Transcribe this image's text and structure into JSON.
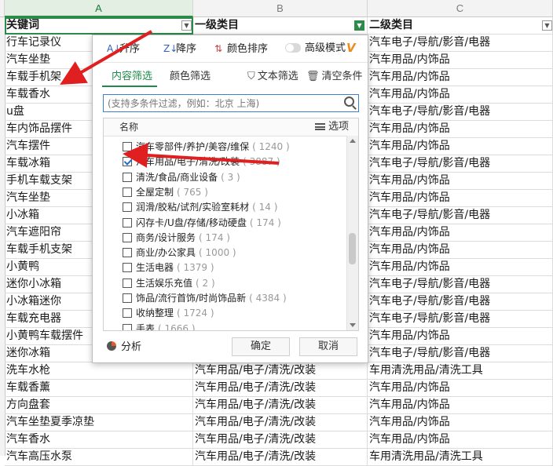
{
  "columns": {
    "a": "A",
    "b": "B",
    "c": "C"
  },
  "header": {
    "keyword": "关键词",
    "cat1": "一级类目",
    "cat2": "二级类目"
  },
  "rows": [
    {
      "k": "行车记录仪",
      "a": "",
      "b": "汽车电子/导航/影音/电器"
    },
    {
      "k": "汽车坐垫",
      "a": "",
      "b": "汽车用品/内饰品"
    },
    {
      "k": "车载手机架",
      "a": "",
      "b": "汽车用品/内饰品"
    },
    {
      "k": "车载香水",
      "a": "",
      "b": "汽车用品/内饰品"
    },
    {
      "k": "u盘",
      "a": "",
      "b": "汽车电子/导航/影音/电器"
    },
    {
      "k": "车内饰品摆件",
      "a": "",
      "b": "汽车用品/内饰品"
    },
    {
      "k": "汽车摆件",
      "a": "",
      "b": "汽车用品/内饰品"
    },
    {
      "k": "车载冰箱",
      "a": "",
      "b": "汽车电子/导航/影音/电器"
    },
    {
      "k": "手机车载支架",
      "a": "",
      "b": "汽车用品/内饰品"
    },
    {
      "k": "汽车坐垫",
      "a": "",
      "b": "汽车用品/内饰品"
    },
    {
      "k": "小冰箱",
      "a": "",
      "b": "汽车电子/导航/影音/电器"
    },
    {
      "k": "汽车遮阳帘",
      "a": "",
      "b": "汽车用品/内饰品"
    },
    {
      "k": "车载手机支架",
      "a": "",
      "b": "汽车用品/内饰品"
    },
    {
      "k": "小黄鸭",
      "a": "",
      "b": "汽车用品/内饰品"
    },
    {
      "k": "迷你小冰箱",
      "a": "",
      "b": "汽车电子/导航/影音/电器"
    },
    {
      "k": "小冰箱迷你",
      "a": "",
      "b": "汽车电子/导航/影音/电器"
    },
    {
      "k": "车载充电器",
      "a": "",
      "b": "汽车电子/导航/影音/电器"
    },
    {
      "k": "小黄鸭车载摆件",
      "a": "",
      "b": "汽车用品/内饰品"
    },
    {
      "k": "迷你冰箱",
      "a": "",
      "b": "汽车电子/导航/影音/电器"
    },
    {
      "k": "洗车水枪",
      "a": "汽车用品/电子/清洗/改装",
      "b": "车用清洗用品/清洗工具"
    },
    {
      "k": "车载香薰",
      "a": "汽车用品/电子/清洗/改装",
      "b": "汽车用品/内饰品"
    },
    {
      "k": "方向盘套",
      "a": "汽车用品/电子/清洗/改装",
      "b": "汽车用品/内饰品"
    },
    {
      "k": "汽车坐垫夏季凉垫",
      "a": "汽车用品/电子/清洗/改装",
      "b": "汽车用品/内饰品"
    },
    {
      "k": "汽车香水",
      "a": "汽车用品/电子/清洗/改装",
      "b": "汽车用品/内饰品"
    },
    {
      "k": "汽车高压水泵",
      "a": "汽车用品/电子/清洗/改装",
      "b": "车用清洗用品/清洗工具"
    }
  ],
  "panel": {
    "sort_asc": "升序",
    "sort_desc": "降序",
    "sort_color": "颜色排序",
    "advanced": "高级模式",
    "tab_content": "内容筛选",
    "tab_color": "颜色筛选",
    "text_filter": "文本筛选",
    "clear": "清空条件",
    "search_placeholder": "(支持多条件过滤，例如：北京 上海)",
    "list_name": "名称",
    "list_options": "选项",
    "items": [
      {
        "label": "汽车零部件/养护/美容/维保",
        "count": "( 1240 )",
        "checked": false
      },
      {
        "label": "汽车用品/电子/清洗/改装",
        "count": "( 3887 )",
        "checked": true
      },
      {
        "label": "清洗/食品/商业设备",
        "count": "( 3 )",
        "checked": false
      },
      {
        "label": "全屋定制",
        "count": "( 765 )",
        "checked": false
      },
      {
        "label": "润滑/胶粘/试剂/实验室耗材",
        "count": "( 14 )",
        "checked": false
      },
      {
        "label": "闪存卡/U盘/存储/移动硬盘",
        "count": "( 174 )",
        "checked": false
      },
      {
        "label": "商务/设计服务",
        "count": "( 174 )",
        "checked": false
      },
      {
        "label": "商业/办公家具",
        "count": "( 1000 )",
        "checked": false
      },
      {
        "label": "生活电器",
        "count": "( 1379 )",
        "checked": false
      },
      {
        "label": "生活娱乐充值",
        "count": "( 2 )",
        "checked": false
      },
      {
        "label": "饰品/流行首饰/时尚饰品新",
        "count": "( 4384 )",
        "checked": false
      },
      {
        "label": "收纳整理",
        "count": "( 1724 )",
        "checked": false
      },
      {
        "label": "手表",
        "count": "( 1666 )",
        "checked": false
      }
    ],
    "analyze": "分析",
    "ok": "确定",
    "cancel": "取消"
  },
  "colors": {
    "accent": "#1e8a4a",
    "annotation": "#e02020"
  }
}
